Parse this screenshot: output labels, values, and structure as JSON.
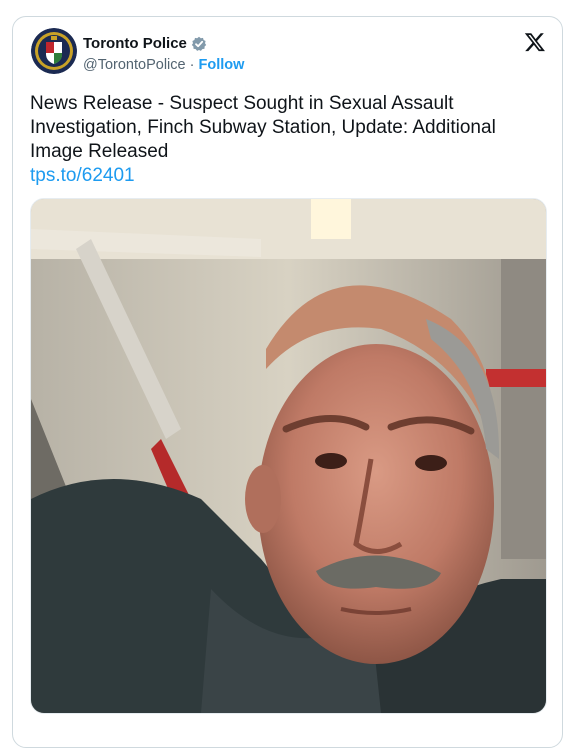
{
  "tweet": {
    "author_name": "Toronto Police",
    "handle": "@TorontoPolice",
    "separator": "·",
    "follow_label": "Follow",
    "text": "News Release - Suspect Sought in Sexual Assault Investigation, Finch Subway Station, Update: Additional Image Released",
    "link": "tps.to/62401"
  },
  "icons": {
    "avatar": "toronto-police-crest",
    "verified": "verified-badge-icon",
    "platform": "x-logo-icon"
  },
  "colors": {
    "link": "#1d9bf0",
    "text": "#0f1419",
    "secondary": "#536471",
    "border": "#cfd9de"
  }
}
